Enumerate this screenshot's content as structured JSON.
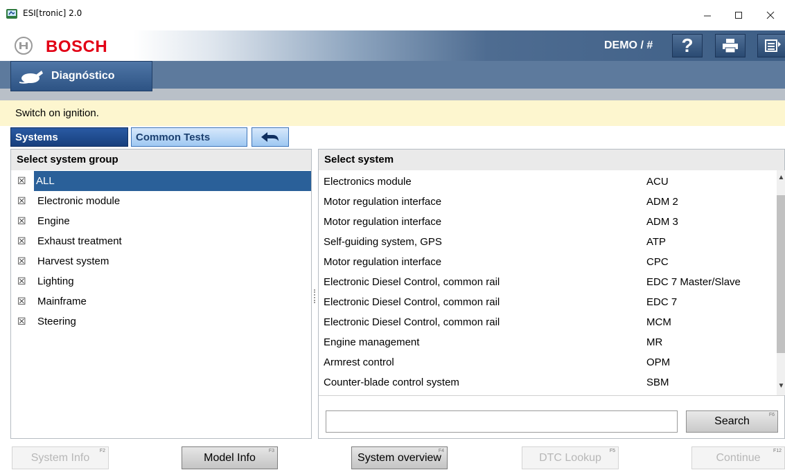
{
  "window": {
    "title": "ESI[tronic] 2.0",
    "minimize_icon": "minimize-icon",
    "maximize_icon": "maximize-icon",
    "close_icon": "close-icon"
  },
  "brand": {
    "name": "BOSCH",
    "user": "DEMO / #",
    "colors": {
      "brand_red": "#e20015",
      "header_blue": "#3d5e86",
      "selected_blue": "#2a6099",
      "message_yellow": "#fdf6cf"
    }
  },
  "toolbar": {
    "help_icon": "help-icon",
    "print_icon": "print-icon",
    "menu_icon": "menu-icon",
    "help_glyph": "?"
  },
  "nav": {
    "diagnostics_label": "Diagnóstico"
  },
  "message": "Switch on ignition.",
  "tabs": {
    "systems": "Systems",
    "common_tests": "Common Tests",
    "back_icon": "back-arrow-icon"
  },
  "left_panel": {
    "header": "Select system group",
    "groups": [
      {
        "label": "ALL",
        "checked": true,
        "selected": true
      },
      {
        "label": "Electronic module",
        "checked": true,
        "selected": false
      },
      {
        "label": "Engine",
        "checked": true,
        "selected": false
      },
      {
        "label": "Exhaust treatment",
        "checked": true,
        "selected": false
      },
      {
        "label": "Harvest system",
        "checked": true,
        "selected": false
      },
      {
        "label": "Lighting",
        "checked": true,
        "selected": false
      },
      {
        "label": "Mainframe",
        "checked": true,
        "selected": false
      },
      {
        "label": "Steering",
        "checked": true,
        "selected": false
      }
    ],
    "checkbox_glyph": "☒"
  },
  "right_panel": {
    "header": "Select system",
    "systems": [
      {
        "name": "Electronics module",
        "code": "ACU"
      },
      {
        "name": "Motor regulation interface",
        "code": "ADM 2"
      },
      {
        "name": "Motor regulation interface",
        "code": "ADM 3"
      },
      {
        "name": "Self-guiding system, GPS",
        "code": "ATP"
      },
      {
        "name": "Motor regulation interface",
        "code": "CPC"
      },
      {
        "name": "Electronic Diesel Control, common rail",
        "code": "EDC 7 Master/Slave"
      },
      {
        "name": "Electronic Diesel Control, common rail",
        "code": "EDC 7"
      },
      {
        "name": "Electronic Diesel Control, common rail",
        "code": "MCM"
      },
      {
        "name": "Engine management",
        "code": "MR"
      },
      {
        "name": "Armrest control",
        "code": "OPM"
      },
      {
        "name": "Counter-blade control system",
        "code": "SBM"
      }
    ],
    "search_value": "",
    "search_label": "Search",
    "search_fkey": "F6"
  },
  "bottom_buttons": [
    {
      "label": "System Info",
      "fkey": "F2",
      "enabled": false
    },
    {
      "label": "Model Info",
      "fkey": "F3",
      "enabled": true
    },
    {
      "label": "System overview",
      "fkey": "F4",
      "enabled": true
    },
    {
      "label": "DTC Lookup",
      "fkey": "F5",
      "enabled": false
    },
    {
      "label": "Continue",
      "fkey": "F12",
      "enabled": false
    }
  ]
}
